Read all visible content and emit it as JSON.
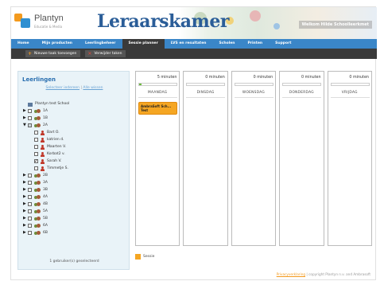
{
  "header": {
    "logo_text": "Plantyn",
    "logo_sub": "Educatie & Media",
    "brand_title": "Leraarskamer",
    "welcome": "Welkom Hilde Schoolleerkmet"
  },
  "nav": {
    "items": [
      {
        "label": "Home",
        "active": false
      },
      {
        "label": "Mijn producten",
        "active": false
      },
      {
        "label": "Leerlingbeheer",
        "active": false
      },
      {
        "label": "Sessie planner",
        "active": true
      },
      {
        "label": "LVS en resultaten",
        "active": false
      },
      {
        "label": "Scholen",
        "active": false
      },
      {
        "label": "Printen",
        "active": false
      },
      {
        "label": "Support",
        "active": false
      }
    ]
  },
  "subbar": {
    "add_task": "Nieuwe taak toevoegen",
    "delete_task": "Verwijder taken"
  },
  "students_panel": {
    "title": "Leerlingen",
    "select_all": "Selecteer iedereen",
    "select_none": "Alle wissen",
    "separator": "|",
    "footer": "1 gebruiker(s) geselecteerd",
    "tree": [
      {
        "label": "Plantyn test School",
        "type": "school",
        "indent": 0,
        "caret": "",
        "checked": "none"
      },
      {
        "label": "1A",
        "type": "group",
        "indent": 0,
        "caret": "▶",
        "checked": "none"
      },
      {
        "label": "1B",
        "type": "group",
        "indent": 0,
        "caret": "▶",
        "checked": "none"
      },
      {
        "label": "2A",
        "type": "group",
        "indent": 0,
        "caret": "▼",
        "checked": "partial"
      },
      {
        "label": "Bart O.",
        "type": "user",
        "indent": 1,
        "caret": "",
        "checked": "none"
      },
      {
        "label": "katrien d.",
        "type": "user",
        "indent": 1,
        "caret": "",
        "checked": "none"
      },
      {
        "label": "Maarten V.",
        "type": "user",
        "indent": 1,
        "caret": "",
        "checked": "none"
      },
      {
        "label": "Korbat2 v.",
        "type": "user",
        "indent": 1,
        "caret": "",
        "checked": "none"
      },
      {
        "label": "Sarah V.",
        "type": "user",
        "indent": 1,
        "caret": "",
        "checked": "checked"
      },
      {
        "label": "Timmetje S.",
        "type": "user",
        "indent": 1,
        "caret": "",
        "checked": "none"
      },
      {
        "label": "2B",
        "type": "group",
        "indent": 0,
        "caret": "▶",
        "checked": "none"
      },
      {
        "label": "3A",
        "type": "group",
        "indent": 0,
        "caret": "▶",
        "checked": "none"
      },
      {
        "label": "3B",
        "type": "group",
        "indent": 0,
        "caret": "▶",
        "checked": "none"
      },
      {
        "label": "4A",
        "type": "group",
        "indent": 0,
        "caret": "▶",
        "checked": "none"
      },
      {
        "label": "4B",
        "type": "group",
        "indent": 0,
        "caret": "▶",
        "checked": "none"
      },
      {
        "label": "5A",
        "type": "group",
        "indent": 0,
        "caret": "▶",
        "checked": "none"
      },
      {
        "label": "5B",
        "type": "group",
        "indent": 0,
        "caret": "▶",
        "checked": "none"
      },
      {
        "label": "6A",
        "type": "group",
        "indent": 0,
        "caret": "▶",
        "checked": "none"
      },
      {
        "label": "6B",
        "type": "group",
        "indent": 0,
        "caret": "▶",
        "checked": "none"
      }
    ]
  },
  "planner": {
    "days": [
      {
        "name": "MAANDAG",
        "minutes": "5 minuten",
        "fill": 0.06,
        "task": "AmbraSoft Sch... Test"
      },
      {
        "name": "DINSDAG",
        "minutes": "0 minuten",
        "fill": 0,
        "task": ""
      },
      {
        "name": "WOENSDAG",
        "minutes": "0 minuten",
        "fill": 0,
        "task": ""
      },
      {
        "name": "DONDERDAG",
        "minutes": "0 minuten",
        "fill": 0,
        "task": ""
      },
      {
        "name": "VRIJDAG",
        "minutes": "0 minuten",
        "fill": 0,
        "task": ""
      }
    ],
    "legend_label": "Sessie",
    "task_color": "#f5a623",
    "progress_color": "#6dbb3c"
  },
  "footer": {
    "privacy": "Privacyverklaring",
    "separator": "|",
    "copyright": "copyright Plantyn n.v. and Ambrasoft"
  },
  "colors": {
    "nav_blue": "#3a86c8",
    "nav_dark": "#3a3a3a",
    "brand_blue": "#2a5d98",
    "accent_orange": "#f39a1e"
  }
}
